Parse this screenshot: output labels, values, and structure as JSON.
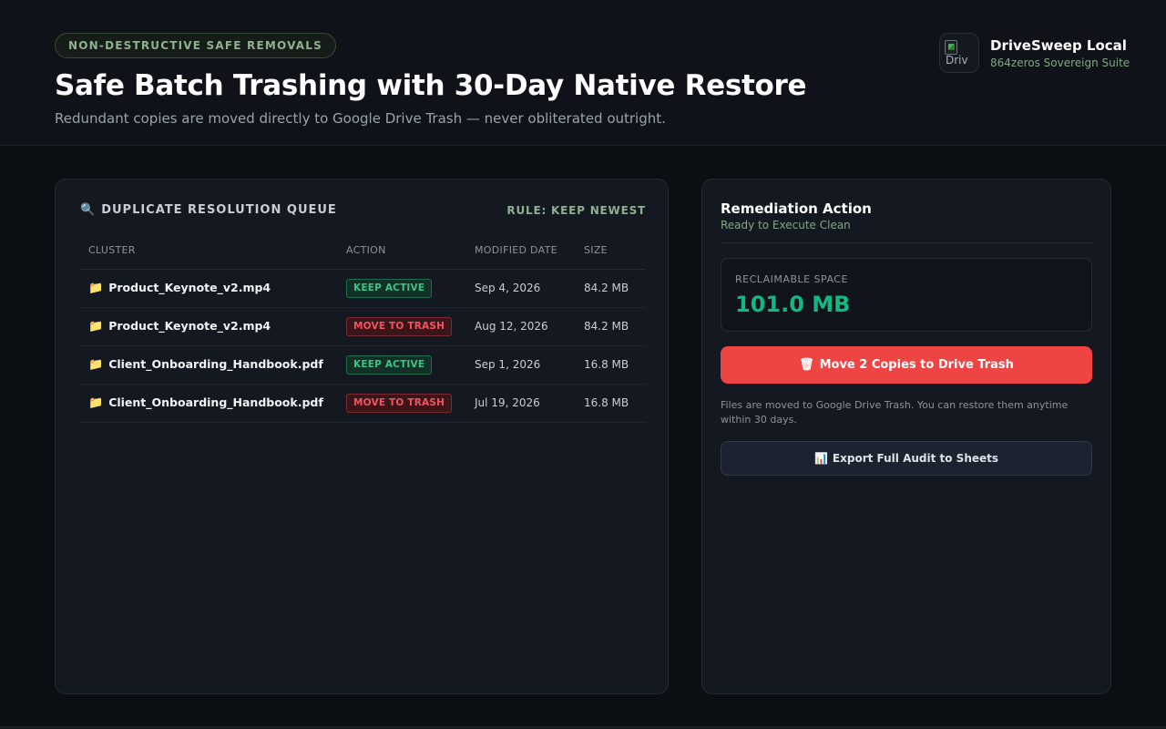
{
  "header": {
    "pill": "NON-DESTRUCTIVE SAFE REMOVALS",
    "title": "Safe Batch Trashing with 30-Day Native Restore",
    "subtitle": "Redundant copies are moved directly to Google Drive Trash — never obliterated outright.",
    "brand": {
      "logo_alt": "Driv",
      "name": "DriveSweep Local",
      "tagline": "864zeros Sovereign Suite"
    }
  },
  "queue": {
    "title": "DUPLICATE RESOLUTION QUEUE",
    "title_icon": "magnifier-icon",
    "rule": "RULE: KEEP NEWEST",
    "columns": [
      "CLUSTER",
      "ACTION",
      "MODIFIED DATE",
      "SIZE"
    ],
    "rows": [
      {
        "name": "Product_Keynote_v2.mp4",
        "action": "KEEP ACTIVE",
        "action_type": "keep",
        "date": "Sep 4, 2026",
        "size": "84.2 MB"
      },
      {
        "name": "Product_Keynote_v2.mp4",
        "action": "MOVE TO TRASH",
        "action_type": "trash",
        "date": "Aug 12, 2026",
        "size": "84.2 MB"
      },
      {
        "name": "Client_Onboarding_Handbook.pdf",
        "action": "KEEP ACTIVE",
        "action_type": "keep",
        "date": "Sep 1, 2026",
        "size": "16.8 MB"
      },
      {
        "name": "Client_Onboarding_Handbook.pdf",
        "action": "MOVE TO TRASH",
        "action_type": "trash",
        "date": "Jul 19, 2026",
        "size": "16.8 MB"
      }
    ]
  },
  "action_panel": {
    "title": "Remediation Action",
    "status": "Ready to Execute Clean",
    "reclaim_label": "RECLAIMABLE SPACE",
    "reclaim_value": "101.0 MB",
    "trash_button": "Move 2 Copies to Drive Trash",
    "note": "Files are moved to Google Drive Trash. You can restore them anytime within 30 days.",
    "export_button": "Export Full Audit to Sheets"
  },
  "colors": {
    "background": "#0b0e13",
    "panel": "#141820",
    "accent_green": "#10b981",
    "danger": "#ef4444",
    "muted_green": "#8fb091"
  }
}
